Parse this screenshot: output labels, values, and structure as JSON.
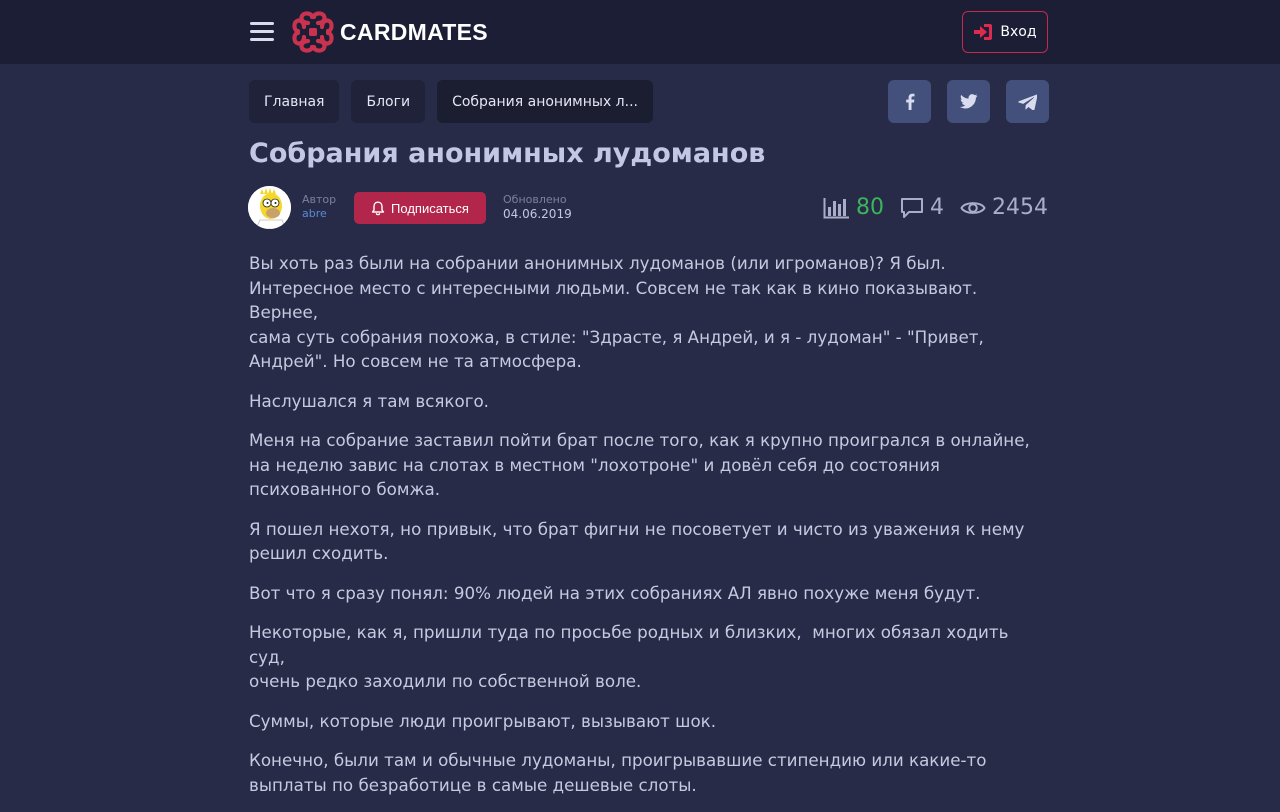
{
  "header": {
    "logo_text": "CARDMATES",
    "login_label": "Вход",
    "accent_color": "#c22a4f"
  },
  "breadcrumb": {
    "items": [
      "Главная",
      "Блоги",
      "Собрания анонимных л..."
    ]
  },
  "share": {
    "icons": [
      "facebook-icon",
      "twitter-icon",
      "telegram-icon"
    ]
  },
  "article": {
    "title": "Собрания анонимных лудоманов",
    "author_label": "Автор",
    "author_name": "abre",
    "subscribe_label": "Подписаться",
    "updated_label": "Обновлено",
    "updated_date": "04.06.2019",
    "rating": "80",
    "comments": "4",
    "views": "2454",
    "paragraphs": [
      "Вы хоть раз были на собрании анонимных лудоманов (или игроманов)? Я был.\nИнтересное место с интересными людьми. Совсем не так как в кино показывают. Вернее,\nсама суть собрания похожа, в стиле: \"Здрасте, я Андрей, и я - лудоман\" - \"Привет,\nАндрей\". Но совсем не та атмосфера.",
      "Наслушался я там всякого.",
      "Меня на собрание заставил пойти брат после того, как я крупно проигрался в онлайне,\nна неделю завис на слотах в местном \"лохотроне\" и довёл себя до состояния\nпсихованного бомжа.",
      "Я пошел нехотя, но привык, что брат фигни не посоветует и чисто из уважения к нему\nрешил сходить.",
      "Вот что я сразу понял: 90% людей на этих собраниях АЛ явно похуже меня будут.",
      "Некоторые, как я, пришли туда по просьбе родных и близких,  многих обязал ходить суд,\nочень редко заходили по собственной воле.",
      "Суммы, которые люди проигрывают, вызывают шок.",
      "Конечно, были там и обычные лудоманы, проигрывавшие стипендию или какие-то\nвыплаты по безработице в самые дешевые слоты."
    ]
  }
}
